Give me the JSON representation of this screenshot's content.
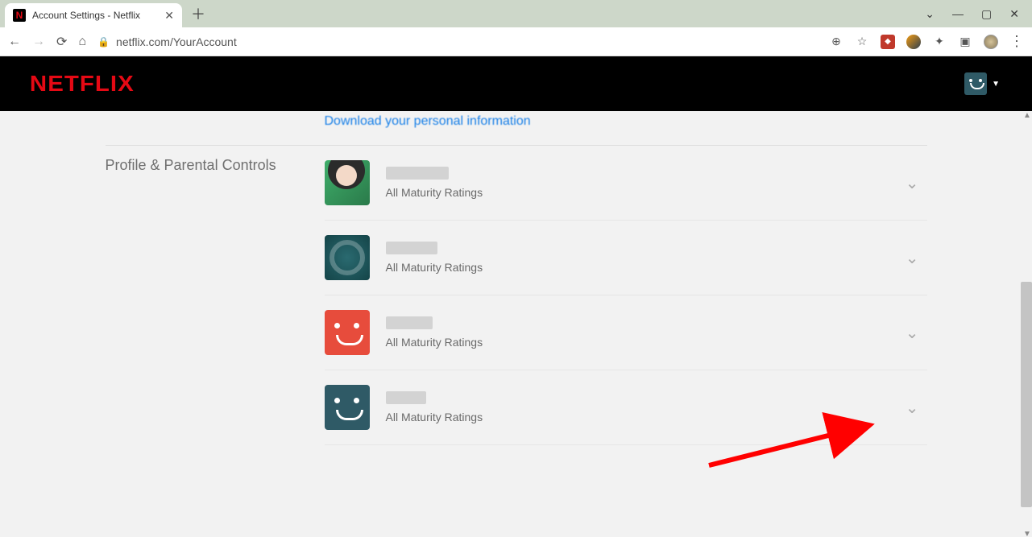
{
  "browser": {
    "tab_title": "Account Settings - Netflix",
    "url": "netflix.com/YourAccount"
  },
  "header": {
    "logo": "NETFLIX"
  },
  "cut_link": "Download your personal information",
  "section_title": "Profile & Parental Controls",
  "profiles": [
    {
      "avatar_class": "green",
      "name_width": 78,
      "maturity": "All Maturity Ratings"
    },
    {
      "avatar_class": "teal",
      "name_width": 64,
      "maturity": "All Maturity Ratings"
    },
    {
      "avatar_class": "red",
      "name_width": 58,
      "maturity": "All Maturity Ratings"
    },
    {
      "avatar_class": "darkteal",
      "name_width": 50,
      "maturity": "All Maturity Ratings"
    }
  ]
}
